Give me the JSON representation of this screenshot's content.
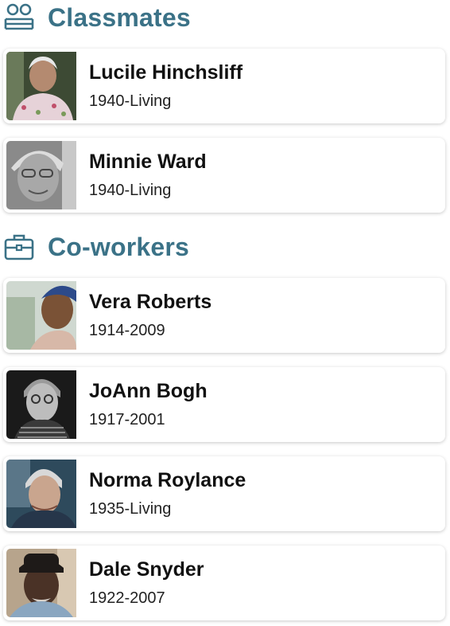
{
  "sections": [
    {
      "title": "Classmates",
      "icon": "classmates-icon",
      "people": [
        {
          "name": "Lucile Hinchsliff",
          "dates": "1940-Living"
        },
        {
          "name": "Minnie Ward",
          "dates": "1940-Living"
        }
      ]
    },
    {
      "title": "Co-workers",
      "icon": "briefcase-icon",
      "people": [
        {
          "name": "Vera Roberts",
          "dates": "1914-2009"
        },
        {
          "name": "JoAnn Bogh",
          "dates": "1917-2001"
        },
        {
          "name": "Norma Roylance",
          "dates": "1935-Living"
        },
        {
          "name": "Dale Snyder",
          "dates": "1922-2007"
        }
      ]
    }
  ],
  "colors": {
    "accent": "#3b7287"
  }
}
